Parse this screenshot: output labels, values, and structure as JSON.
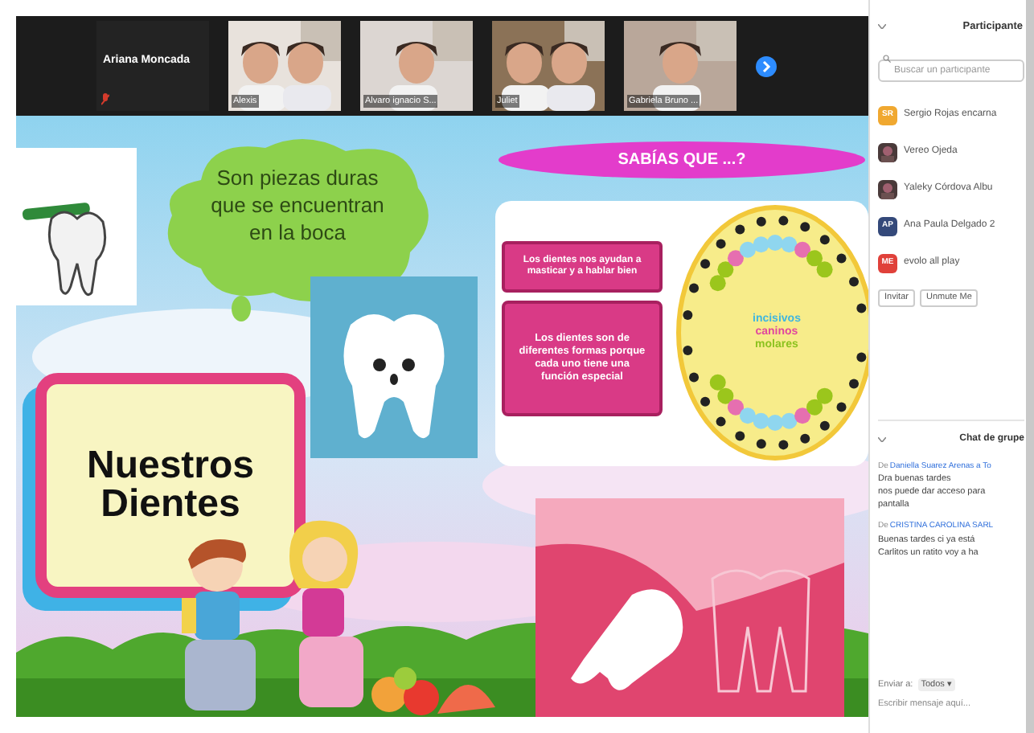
{
  "video_strip": {
    "tiles": [
      {
        "name": "Ariana Moncada",
        "kind": "no_video",
        "muted": true
      },
      {
        "name": "Alexis",
        "kind": "video",
        "muted": false
      },
      {
        "name": "Alvaro ignacio S...",
        "kind": "video",
        "muted": false
      },
      {
        "name": "Juliet",
        "kind": "video",
        "muted": false
      },
      {
        "name": "Gabriela Bruno ...",
        "kind": "video",
        "muted": false
      }
    ]
  },
  "slide": {
    "cloud_text": "Son piezas duras que se encuentran en la boca",
    "title": "Nuestros Dientes",
    "banner": "SABÍAS QUE ...?",
    "facts": [
      "Los dientes nos ayudan a masticar y a hablar bien",
      "Los dientes son de diferentes formas porque cada uno tiene una función especial"
    ],
    "legend": [
      {
        "label": "incisivos",
        "color": "#3fb6e0"
      },
      {
        "label": "caninos",
        "color": "#e0479e"
      },
      {
        "label": "molares",
        "color": "#8cc21f"
      }
    ]
  },
  "participants": {
    "title": "Participante",
    "search": {
      "placeholder": "Buscar un participante"
    },
    "items": [
      {
        "name": "Sergio Rojas encarna",
        "kind": "initials",
        "initials": "SR",
        "color": "#f0a830"
      },
      {
        "name": "Vereo Ojeda"
      },
      {
        "name": "Yaleky Córdova Albu"
      },
      {
        "name": "Ana Paula Delgado 2",
        "kind": "initials",
        "initials": "AP",
        "color": "#34497a"
      },
      {
        "name": "evolo all play",
        "kind": "initials",
        "initials": "ME",
        "color": "#e0413a"
      }
    ],
    "buttons": [
      "Invitar",
      "Unmute Me"
    ]
  },
  "chat": {
    "title": "Chat de grupe",
    "messages": [
      {
        "prefix": "De",
        "sender": "Daniella Suarez Arenas a To",
        "lines": [
          "Dra buenas tardes",
          "nos puede dar acceso para",
          "pantalla"
        ]
      },
      {
        "prefix": "De",
        "sender": "CRISTINA CAROLINA SARL",
        "lines": [
          "Buenas tardes ci ya está",
          "Carlitos un ratito voy a ha"
        ]
      }
    ],
    "send_to_label": "Enviar a:",
    "send_to_value": "Todos ▾",
    "input": {
      "placeholder": "Escribir mensaje aquí..."
    }
  }
}
